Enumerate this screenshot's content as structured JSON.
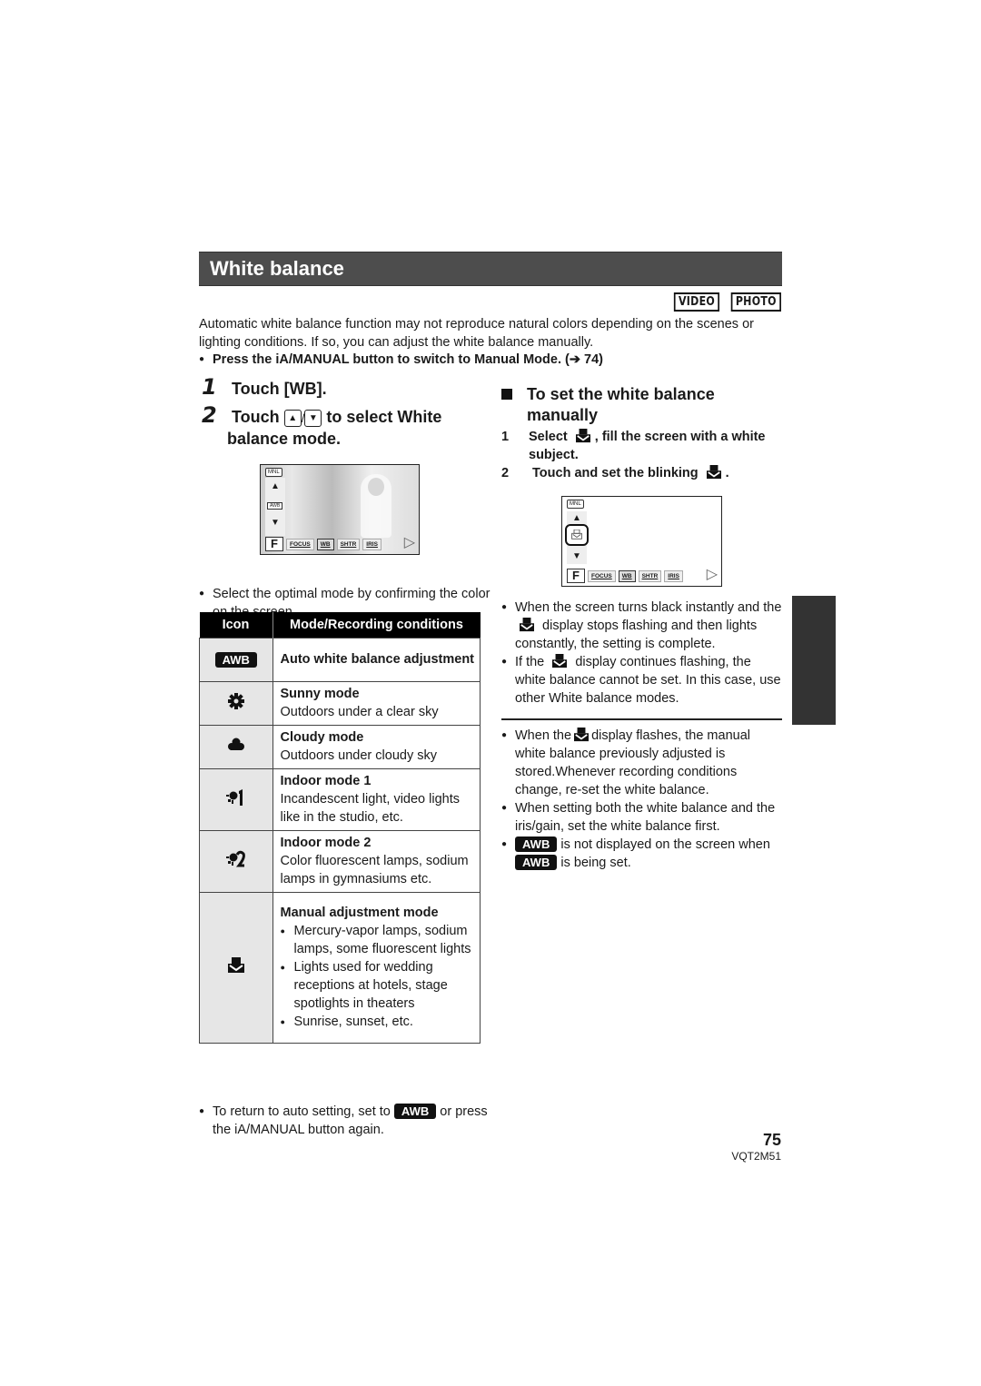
{
  "title": "White balance",
  "mode_badges": [
    "VIDEO",
    "PHOTO"
  ],
  "intro": "Automatic white balance function may not reproduce natural colors depending on the scenes or lighting conditions. If so, you can adjust the white balance manually.",
  "note_manual_mode": "Press the iA/MANUAL button to switch to Manual Mode. (➔ 74)",
  "steps": [
    {
      "num": "1",
      "text": "Touch [WB]."
    },
    {
      "num": "2",
      "text_before": "Touch",
      "up_icon": "▲",
      "sep": "/",
      "down_icon": "▼",
      "text_after": "to select White",
      "text_line2": "balance mode."
    }
  ],
  "camera_screen_1": {
    "mnl": "MNL",
    "selected_mode": "AWB",
    "buttons": [
      "FOCUS",
      "WB",
      "SHTR",
      "IRIS"
    ],
    "selected_button": "WB",
    "f_label": "F"
  },
  "camera_screen_2": {
    "mnl": "MNL",
    "buttons": [
      "FOCUS",
      "WB",
      "SHTR",
      "IRIS"
    ],
    "selected_button": "WB",
    "f_label": "F"
  },
  "select_note": "Select the optimal mode by confirming the color on the screen.",
  "table": {
    "headers": [
      "Icon",
      "Mode/Recording conditions"
    ],
    "rows": [
      {
        "icon": "awb-icon",
        "icon_label": "AWB",
        "mode": "Auto white balance adjustment",
        "desc": ""
      },
      {
        "icon": "sunny-icon",
        "icon_label": "✸",
        "mode": "Sunny mode",
        "desc": "Outdoors under a clear sky"
      },
      {
        "icon": "cloudy-icon",
        "icon_label": "☁",
        "mode": "Cloudy mode",
        "desc": "Outdoors under cloudy sky"
      },
      {
        "icon": "indoor-1-icon",
        "icon_label": "☼1",
        "mode": "Indoor mode 1",
        "desc": "Incandescent light, video lights like in the studio, etc."
      },
      {
        "icon": "indoor-2-icon",
        "icon_label": "☼2",
        "mode": "Indoor mode 2",
        "desc": "Color fluorescent lamps, sodium lamps in gymnasiums etc."
      },
      {
        "icon": "manual-wb-icon",
        "mode": "Manual adjustment mode",
        "bullets": [
          "Mercury-vapor lamps, sodium lamps, some fluorescent lights",
          "Lights used for wedding receptions at hotels, stage spotlights in theaters",
          "Sunrise, sunset, etc."
        ]
      }
    ]
  },
  "return_note": {
    "before": "To return to auto setting, set to",
    "chip": "AWB",
    "after": "or press the iA/MANUAL button again."
  },
  "manual_section": {
    "heading": "To set the white balance manually",
    "steps": [
      {
        "num": "1",
        "before": "Select",
        "after": ", fill the screen with a white subject."
      },
      {
        "num": "2",
        "before": "Touch and set the blinking",
        "after": "."
      }
    ],
    "notes_a": [
      {
        "before": "When the screen turns black instantly and the",
        "after": "display stops flashing and then lights constantly, the setting is complete."
      },
      {
        "before": "If the",
        "after": "display continues flashing, the white balance cannot be set. In this case, use other White balance modes."
      }
    ],
    "notes_b": [
      {
        "before": "When the",
        "after": "display flashes, the manual white balance previously adjusted is stored.Whenever recording conditions change, re-set the white balance."
      },
      {
        "text": "When setting both the white balance and the iris/gain, set the white balance first."
      },
      {
        "chip": "AWB",
        "mid": "is not displayed on the screen when",
        "chip2": "AWB",
        "after": "is being set."
      }
    ]
  },
  "footer": {
    "page_number": "75",
    "doc_code": "VQT2M51"
  }
}
